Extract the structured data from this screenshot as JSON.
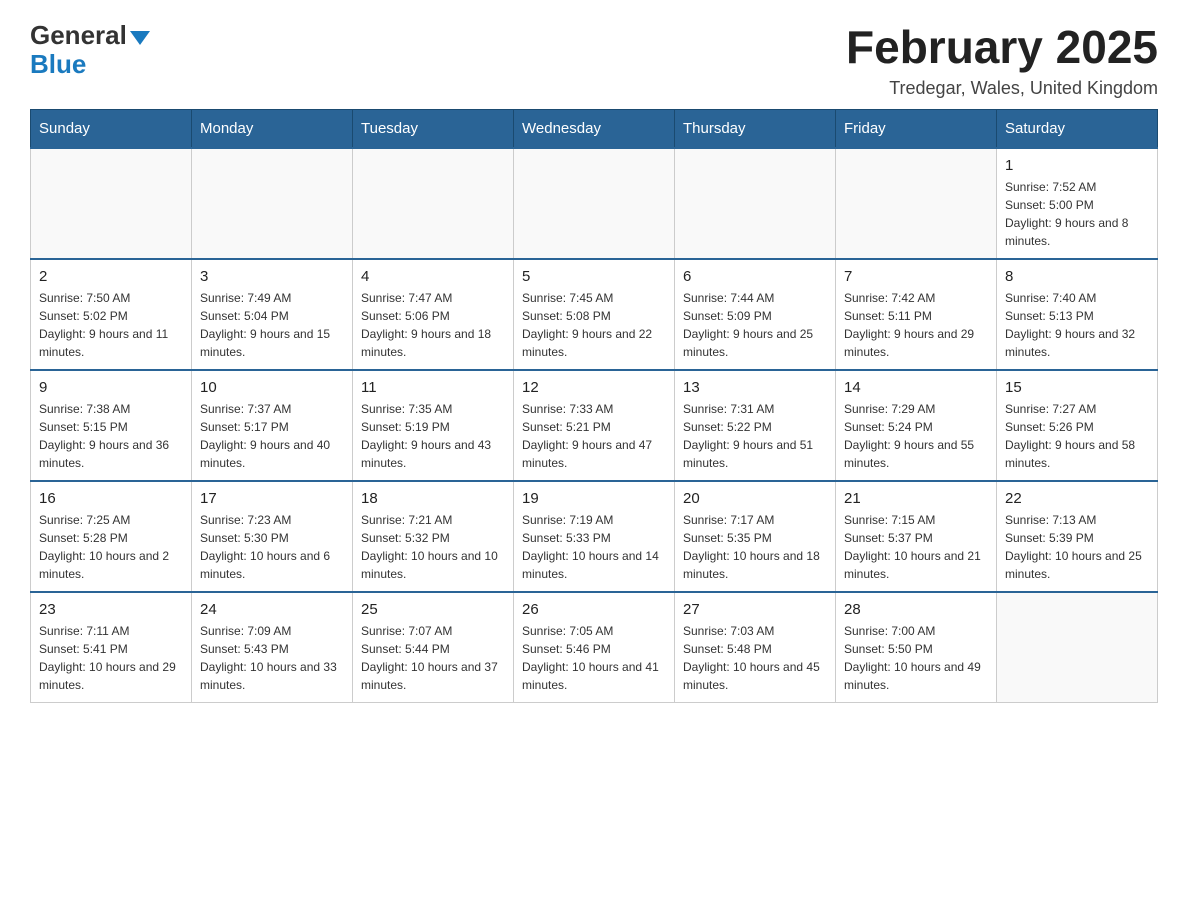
{
  "header": {
    "logo_general": "General",
    "logo_blue": "Blue",
    "title": "February 2025",
    "subtitle": "Tredegar, Wales, United Kingdom"
  },
  "days_of_week": [
    "Sunday",
    "Monday",
    "Tuesday",
    "Wednesday",
    "Thursday",
    "Friday",
    "Saturday"
  ],
  "weeks": [
    [
      {
        "day": "",
        "info": ""
      },
      {
        "day": "",
        "info": ""
      },
      {
        "day": "",
        "info": ""
      },
      {
        "day": "",
        "info": ""
      },
      {
        "day": "",
        "info": ""
      },
      {
        "day": "",
        "info": ""
      },
      {
        "day": "1",
        "info": "Sunrise: 7:52 AM\nSunset: 5:00 PM\nDaylight: 9 hours and 8 minutes."
      }
    ],
    [
      {
        "day": "2",
        "info": "Sunrise: 7:50 AM\nSunset: 5:02 PM\nDaylight: 9 hours and 11 minutes."
      },
      {
        "day": "3",
        "info": "Sunrise: 7:49 AM\nSunset: 5:04 PM\nDaylight: 9 hours and 15 minutes."
      },
      {
        "day": "4",
        "info": "Sunrise: 7:47 AM\nSunset: 5:06 PM\nDaylight: 9 hours and 18 minutes."
      },
      {
        "day": "5",
        "info": "Sunrise: 7:45 AM\nSunset: 5:08 PM\nDaylight: 9 hours and 22 minutes."
      },
      {
        "day": "6",
        "info": "Sunrise: 7:44 AM\nSunset: 5:09 PM\nDaylight: 9 hours and 25 minutes."
      },
      {
        "day": "7",
        "info": "Sunrise: 7:42 AM\nSunset: 5:11 PM\nDaylight: 9 hours and 29 minutes."
      },
      {
        "day": "8",
        "info": "Sunrise: 7:40 AM\nSunset: 5:13 PM\nDaylight: 9 hours and 32 minutes."
      }
    ],
    [
      {
        "day": "9",
        "info": "Sunrise: 7:38 AM\nSunset: 5:15 PM\nDaylight: 9 hours and 36 minutes."
      },
      {
        "day": "10",
        "info": "Sunrise: 7:37 AM\nSunset: 5:17 PM\nDaylight: 9 hours and 40 minutes."
      },
      {
        "day": "11",
        "info": "Sunrise: 7:35 AM\nSunset: 5:19 PM\nDaylight: 9 hours and 43 minutes."
      },
      {
        "day": "12",
        "info": "Sunrise: 7:33 AM\nSunset: 5:21 PM\nDaylight: 9 hours and 47 minutes."
      },
      {
        "day": "13",
        "info": "Sunrise: 7:31 AM\nSunset: 5:22 PM\nDaylight: 9 hours and 51 minutes."
      },
      {
        "day": "14",
        "info": "Sunrise: 7:29 AM\nSunset: 5:24 PM\nDaylight: 9 hours and 55 minutes."
      },
      {
        "day": "15",
        "info": "Sunrise: 7:27 AM\nSunset: 5:26 PM\nDaylight: 9 hours and 58 minutes."
      }
    ],
    [
      {
        "day": "16",
        "info": "Sunrise: 7:25 AM\nSunset: 5:28 PM\nDaylight: 10 hours and 2 minutes."
      },
      {
        "day": "17",
        "info": "Sunrise: 7:23 AM\nSunset: 5:30 PM\nDaylight: 10 hours and 6 minutes."
      },
      {
        "day": "18",
        "info": "Sunrise: 7:21 AM\nSunset: 5:32 PM\nDaylight: 10 hours and 10 minutes."
      },
      {
        "day": "19",
        "info": "Sunrise: 7:19 AM\nSunset: 5:33 PM\nDaylight: 10 hours and 14 minutes."
      },
      {
        "day": "20",
        "info": "Sunrise: 7:17 AM\nSunset: 5:35 PM\nDaylight: 10 hours and 18 minutes."
      },
      {
        "day": "21",
        "info": "Sunrise: 7:15 AM\nSunset: 5:37 PM\nDaylight: 10 hours and 21 minutes."
      },
      {
        "day": "22",
        "info": "Sunrise: 7:13 AM\nSunset: 5:39 PM\nDaylight: 10 hours and 25 minutes."
      }
    ],
    [
      {
        "day": "23",
        "info": "Sunrise: 7:11 AM\nSunset: 5:41 PM\nDaylight: 10 hours and 29 minutes."
      },
      {
        "day": "24",
        "info": "Sunrise: 7:09 AM\nSunset: 5:43 PM\nDaylight: 10 hours and 33 minutes."
      },
      {
        "day": "25",
        "info": "Sunrise: 7:07 AM\nSunset: 5:44 PM\nDaylight: 10 hours and 37 minutes."
      },
      {
        "day": "26",
        "info": "Sunrise: 7:05 AM\nSunset: 5:46 PM\nDaylight: 10 hours and 41 minutes."
      },
      {
        "day": "27",
        "info": "Sunrise: 7:03 AM\nSunset: 5:48 PM\nDaylight: 10 hours and 45 minutes."
      },
      {
        "day": "28",
        "info": "Sunrise: 7:00 AM\nSunset: 5:50 PM\nDaylight: 10 hours and 49 minutes."
      },
      {
        "day": "",
        "info": ""
      }
    ]
  ]
}
